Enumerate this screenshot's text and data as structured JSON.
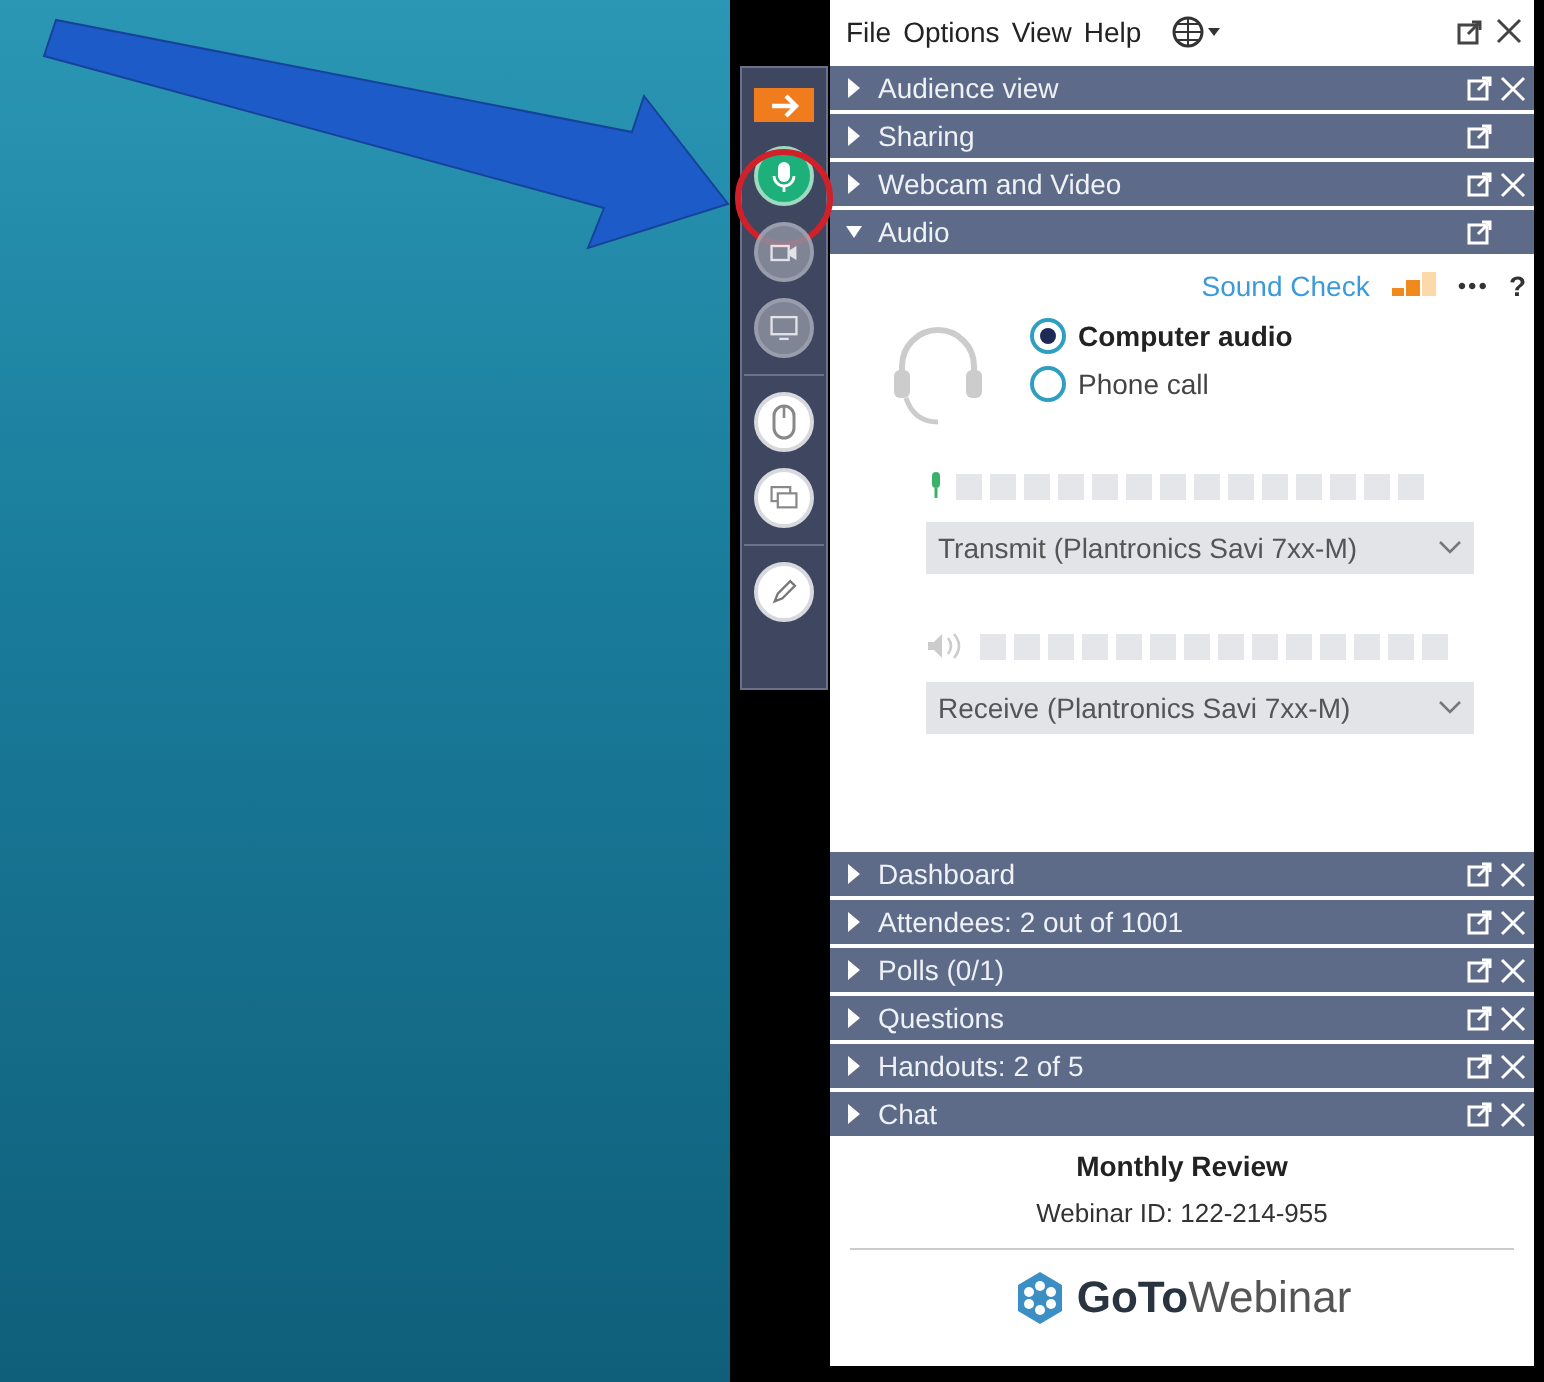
{
  "menu_bar": {
    "items": [
      "File",
      "Options",
      "View",
      "Help"
    ]
  },
  "toolbar": [
    {
      "kind": "show-panel",
      "on": false,
      "disabled": false
    },
    {
      "kind": "mic",
      "on": true,
      "disabled": false
    },
    {
      "kind": "webcam",
      "on": false,
      "disabled": true
    },
    {
      "kind": "screen",
      "on": false,
      "disabled": true
    },
    {
      "kind": "mouse",
      "on": false,
      "disabled": false
    },
    {
      "kind": "screens",
      "on": false,
      "disabled": false
    },
    {
      "kind": "pen",
      "on": false,
      "disabled": false
    }
  ],
  "panels_top": [
    {
      "title": "Audience view",
      "expanded": false,
      "closable": true
    },
    {
      "title": "Sharing",
      "expanded": false,
      "closable": false
    },
    {
      "title": "Webcam and Video",
      "expanded": false,
      "closable": true
    },
    {
      "title": "Audio",
      "expanded": true,
      "closable": false
    }
  ],
  "audio": {
    "sound_check": "Sound Check",
    "more": "•••",
    "help": "?",
    "options": [
      {
        "label": "Computer audio",
        "selected": true
      },
      {
        "label": "Phone call",
        "selected": false
      }
    ],
    "mic_device": "Transmit (Plantronics Savi 7xx-M)",
    "speaker_device": "Receive (Plantronics Savi 7xx-M)"
  },
  "panels_bottom": [
    {
      "title": "Dashboard",
      "expanded": false,
      "closable": true
    },
    {
      "title": "Attendees:  2 out of 1001",
      "expanded": false,
      "closable": true
    },
    {
      "title": "Polls (0/1)",
      "expanded": false,
      "closable": true
    },
    {
      "title": "Questions",
      "expanded": false,
      "closable": true
    },
    {
      "title": "Handouts: 2 of 5",
      "expanded": false,
      "closable": true
    },
    {
      "title": "Chat",
      "expanded": false,
      "closable": true
    }
  ],
  "footer": {
    "webinar_title": "Monthly Review",
    "webinar_id": "Webinar ID: 122-214-955",
    "logo_bold": "GoTo",
    "logo_light": "Webinar"
  }
}
